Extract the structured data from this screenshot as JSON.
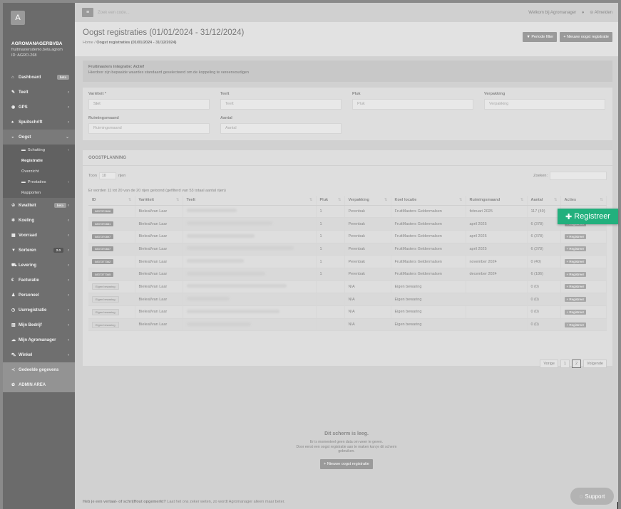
{
  "sidebar": {
    "logo_letter": "A",
    "org": "AGROMANAGERBVBA",
    "email": "fruitmastersdemo.beta.agrom",
    "id": "ID: AGRO-268",
    "items": [
      {
        "icon": "⌂",
        "label": "Dashboard",
        "badge": "beta"
      },
      {
        "icon": "✎",
        "label": "Teelt",
        "chev": "‹"
      },
      {
        "icon": "◉",
        "label": "GPS",
        "chev": "‹"
      },
      {
        "icon": "♠",
        "label": "Spuitschrift",
        "chev": "‹"
      },
      {
        "icon": "◒",
        "label": "Oogst",
        "chev": "⌄"
      }
    ],
    "oogst_sub": [
      {
        "label": "Schatting",
        "chev": "‹"
      },
      {
        "label": "Registratie"
      },
      {
        "label": "Overzicht"
      },
      {
        "label": "Prestaties",
        "chev": "‹"
      },
      {
        "label": "Rapporten"
      }
    ],
    "items2": [
      {
        "icon": "♔",
        "label": "Kwaliteit",
        "badge": "beta",
        "chev": "‹"
      },
      {
        "icon": "❄",
        "label": "Koeling",
        "chev": "‹"
      },
      {
        "icon": "▦",
        "label": "Voorraad",
        "chev": "‹"
      },
      {
        "icon": "▼",
        "label": "Sorteren",
        "badge": "2.0",
        "chev": "‹"
      },
      {
        "icon": "⛟",
        "label": "Levering",
        "chev": "‹"
      },
      {
        "icon": "€",
        "label": "Facturatie",
        "chev": "‹"
      },
      {
        "icon": "♟",
        "label": "Personeel",
        "chev": "‹"
      },
      {
        "icon": "◷",
        "label": "Uurregistratie",
        "chev": "‹"
      },
      {
        "icon": "▥",
        "label": "Mijn Bedrijf",
        "chev": "‹"
      },
      {
        "icon": "☁",
        "label": "Mijn Agromanager",
        "chev": "‹"
      },
      {
        "icon": "⛍",
        "label": "Winkel",
        "chev": "‹"
      },
      {
        "icon": "≺",
        "label": "Gedeelde gegevens"
      },
      {
        "icon": "✿",
        "label": "ADMIN AREA"
      }
    ]
  },
  "topbar": {
    "search_placeholder": "Zoek een code...",
    "welcome": "Welkom bij Agromanager",
    "logout": "⊝ Afmelden"
  },
  "page": {
    "title": "Oogst registraties (01/01/2024 - 31/12/2024)",
    "breadcrumb_home": "Home",
    "breadcrumb_current": "Oogst registraties (01/01/2024 - 31/12/2024)",
    "btn_periode": "▼ Periode filter",
    "btn_nieuwe": "+ Nieuwe oogst registratie"
  },
  "alert": {
    "title": "Fruitmasters integratie: Actief",
    "text": "Hierdoor zijn bepaalde waardes standaard geselecteerd om de koppeling te vereenvoudigen"
  },
  "form": {
    "variety_label": "Variëteit *",
    "variety_value": "Stet",
    "teelt_label": "Teelt",
    "teelt_placeholder": "Teelt",
    "pluk_label": "Pluk",
    "pluk_placeholder": "Pluk",
    "verpakking_label": "Verpakking",
    "verpakking_placeholder": "Verpakking",
    "ruimingsmaand_label": "Ruimingsmaand",
    "ruimingsmaand_placeholder": "Ruimingsmaand",
    "aantal_label": "Aantal",
    "aantal_placeholder": "Aantal"
  },
  "oogstplanning": {
    "header": "OOGSTPLANNING",
    "toon": "Toon",
    "toon_value": "10",
    "rijen": "rijen",
    "zoeken": "Zoeken:",
    "info": "Er worden 11 tot 20 van de 20 rijen getoond (gefilterd van 53 totaal aantal rijen)",
    "columns": [
      "ID",
      "Variëteit",
      "Teelt",
      "Pluk",
      "Verpakking",
      "Koel locatie",
      "Ruimingsmaand",
      "Aantal",
      "Acties"
    ],
    "rows": [
      {
        "id": "0837372606",
        "variety": "Bieleaf/van Laar",
        "pluk": "1",
        "verpakking": "Perenbak",
        "koel": "FruitMasters Geldermalsen",
        "maand": "februari 2025",
        "aantal": "117 (49)",
        "light": false
      },
      {
        "id": "0837370881",
        "variety": "Bieleaf/van Laar",
        "pluk": "1",
        "verpakking": "Perenbak",
        "koel": "FruitMasters Geldermalsen",
        "maand": "april 2025",
        "aantal": "6 (378)",
        "light": false
      },
      {
        "id": "0837370897",
        "variety": "Bieleaf/van Laar",
        "pluk": "1",
        "verpakking": "Perenbak",
        "koel": "FruitMasters Geldermalsen",
        "maand": "april 2025",
        "aantal": "6 (378)",
        "light": false
      },
      {
        "id": "0837370847",
        "variety": "Bieleaf/van Laar",
        "pluk": "1",
        "verpakking": "Perenbak",
        "koel": "FruitMasters Geldermalsen",
        "maand": "april 2025",
        "aantal": "6 (378)",
        "light": false
      },
      {
        "id": "0837377362",
        "variety": "Bieleaf/van Laar",
        "pluk": "1",
        "verpakking": "Perenbak",
        "koel": "FruitMasters Geldermalsen",
        "maand": "november 2024",
        "aantal": "0 (40)",
        "light": false
      },
      {
        "id": "0837377365",
        "variety": "Bieleaf/van Laar",
        "pluk": "1",
        "verpakking": "Perenbak",
        "koel": "FruitMasters Geldermalsen",
        "maand": "december 2024",
        "aantal": "6 (186)",
        "light": false
      },
      {
        "id": "Eigen bewaring",
        "variety": "Bieleaf/van Laar",
        "pluk": "",
        "verpakking": "N/A",
        "koel": "Eigen bewaring",
        "maand": "",
        "aantal": "0 (0)",
        "light": true
      },
      {
        "id": "Eigen bewaring",
        "variety": "Bieleaf/van Laar",
        "pluk": "",
        "verpakking": "N/A",
        "koel": "Eigen bewaring",
        "maand": "",
        "aantal": "0 (0)",
        "light": true
      },
      {
        "id": "Eigen bewaring",
        "variety": "Bieleaf/van Laar",
        "pluk": "",
        "verpakking": "N/A",
        "koel": "Eigen bewaring",
        "maand": "",
        "aantal": "0 (0)",
        "light": true
      },
      {
        "id": "Eigen bewaring",
        "variety": "Bieleaf/van Laar",
        "pluk": "",
        "verpakking": "N/A",
        "koel": "Eigen bewaring",
        "maand": "",
        "aantal": "0 (0)",
        "light": true
      }
    ],
    "action_label": "+ Registreer",
    "pager_prev": "Vorige",
    "pager_p1": "1",
    "pager_p2": "2",
    "pager_next": "Volgende"
  },
  "empty": {
    "title": "Dit scherm is leeg.",
    "line1": "Er is momenteel geen data om weer te geven.",
    "line2": "Door eerst een oogst registratie aan te maken kan je dit scherm",
    "line3": "gebruiken.",
    "button": "+ Nieuwe oogst registratie"
  },
  "footer": {
    "bold": "Heb je een vertaal- of schrijffout opgemerkt?",
    "text": "Laat het ons zeker weten, zo wordt Agromanager alleen maar beter."
  },
  "support_label": "Support",
  "highlight_label": "Registreer"
}
